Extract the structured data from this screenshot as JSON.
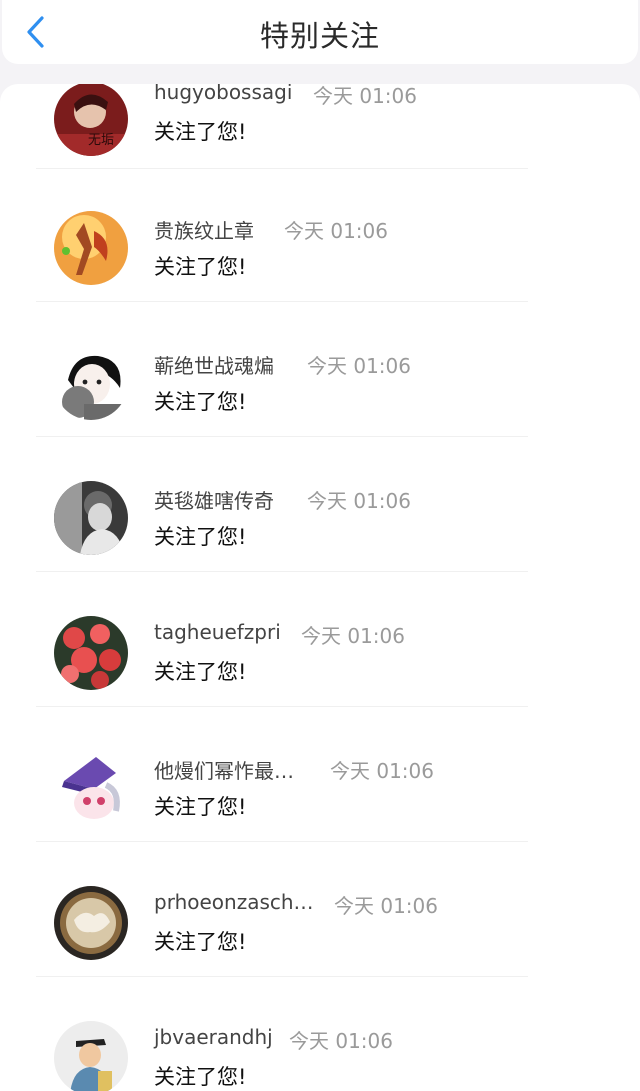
{
  "header": {
    "title": "特别关注"
  },
  "items": [
    {
      "name": "hugyobossagi",
      "time": "今天 01:06",
      "message": "关注了您!"
    },
    {
      "name": "贵族纹止章",
      "time": "今天 01:06",
      "message": "关注了您!"
    },
    {
      "name": "蕲绝世战魂煸",
      "time": "今天 01:06",
      "message": "关注了您!"
    },
    {
      "name": "英毯雄嗐传奇",
      "time": "今天 01:06",
      "message": "关注了您!"
    },
    {
      "name": "tagheuefzpri",
      "time": "今天 01:06",
      "message": "关注了您!"
    },
    {
      "name": "他熳们幂怍最…",
      "time": "今天 01:06",
      "message": "关注了您!"
    },
    {
      "name": "prhoeonzasch…",
      "time": "今天 01:06",
      "message": "关注了您!"
    },
    {
      "name": "jbvaerandhj",
      "time": "今天 01:06",
      "message": "关注了您!"
    }
  ],
  "icons": {
    "back": "chevron-left-icon"
  },
  "colors": {
    "accent": "#2f8ff0",
    "background": "#f4f3f6"
  }
}
